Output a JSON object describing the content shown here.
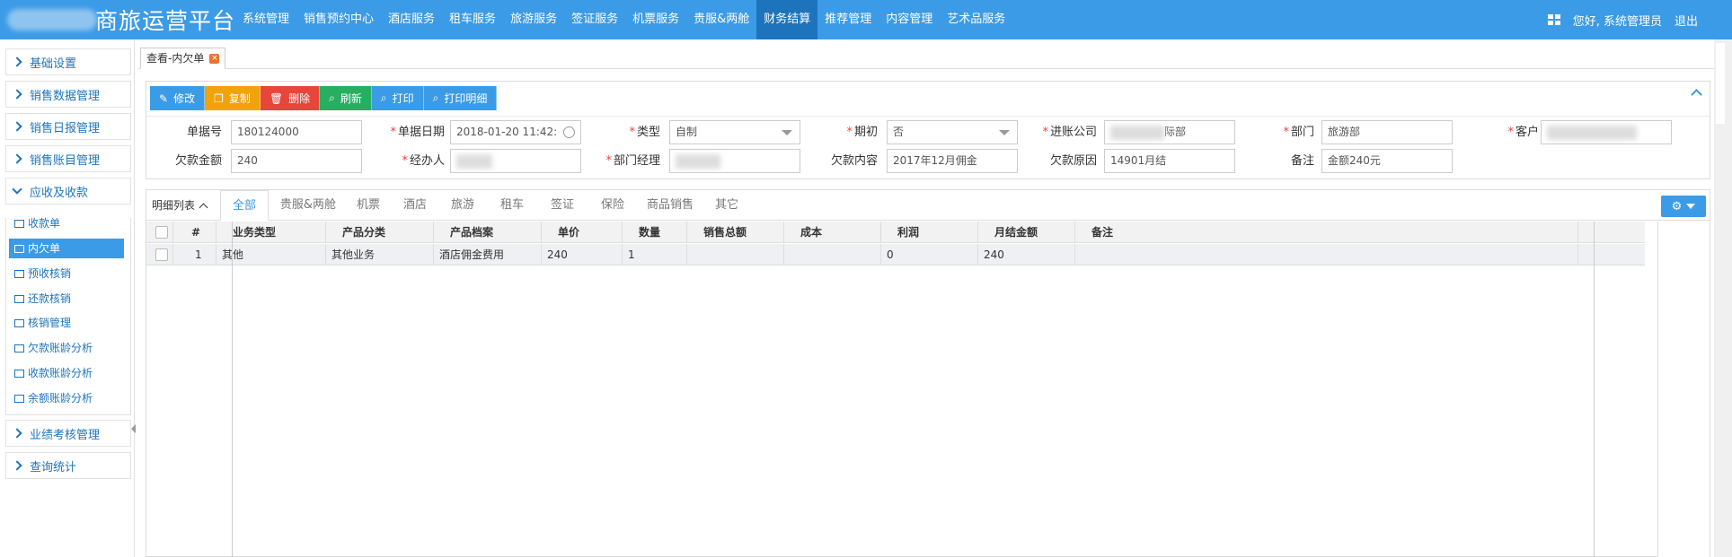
{
  "app": {
    "title": "商旅运营平台"
  },
  "nav": {
    "items": [
      "系统管理",
      "销售预约中心",
      "酒店服务",
      "租车服务",
      "旅游服务",
      "签证服务",
      "机票服务",
      "贵服&两舱",
      "财务结算",
      "推荐管理",
      "内容管理",
      "艺术品服务"
    ],
    "active_index": 8,
    "user_greeting": "您好, 系统管理员",
    "logout": "退出"
  },
  "sidebar": {
    "groups_top": [
      "基础设置",
      "销售数据管理",
      "销售日报管理",
      "销售账目管理"
    ],
    "expanded_group": "应收及收款",
    "sub_items": [
      "收款单",
      "内欠单",
      "预收核销",
      "还款核销",
      "核销管理",
      "欠款账龄分析",
      "收款账龄分析",
      "余额账龄分析"
    ],
    "active_sub_index": 1,
    "groups_bottom": [
      "业绩考核管理",
      "查询统计"
    ]
  },
  "tabs": {
    "current": "查看-内欠单",
    "close_icon": "×"
  },
  "toolbar": {
    "edit": "修改",
    "copy": "复制",
    "delete": "删除",
    "refresh": "刷新",
    "print": "打印",
    "print_detail": "打印明细"
  },
  "form": {
    "doc_no_label": "单据号",
    "doc_no": "180124000",
    "doc_date_label": "单据日期",
    "doc_date": "2018-01-20 11:42:",
    "type_label": "类型",
    "type": "自制",
    "initial_label": "期初",
    "initial": "否",
    "account_company_label": "进账公司",
    "account_company": "际部",
    "dept_label": "部门",
    "dept": "旅游部",
    "customer_label": "客户",
    "debt_amount_label": "欠款金额",
    "debt_amount": "240",
    "handler_label": "经办人",
    "dept_manager_label": "部门经理",
    "debt_content_label": "欠款内容",
    "debt_content": "2017年12月佣金",
    "debt_reason_label": "欠款原因",
    "debt_reason": "14901月结",
    "remark_label": "备注",
    "remark": "金额240元"
  },
  "detail": {
    "list_title": "明细列表",
    "tabs": [
      "全部",
      "贵服&两舱",
      "机票",
      "酒店",
      "旅游",
      "租车",
      "签证",
      "保险",
      "商品销售",
      "其它"
    ],
    "active_tab": 0,
    "columns": [
      "#",
      "业务类型",
      "产品分类",
      "产品档案",
      "单价",
      "数量",
      "销售总额",
      "成本",
      "利润",
      "月结金额",
      "备注"
    ],
    "rows": [
      {
        "no": "1",
        "biz_type": "其他",
        "category": "其他业务",
        "product": "酒店佣金费用",
        "price": "240",
        "qty": "1",
        "sales_total": "",
        "cost": "",
        "profit": "0",
        "monthly_amount": "240",
        "remark": ""
      }
    ]
  },
  "icons": {
    "edit": "pencil-icon",
    "copy": "copy-icon",
    "delete": "trash-icon",
    "refresh": "search-icon",
    "print": "zoom-icon",
    "settings": "gear-icon"
  },
  "colors": {
    "primary": "#3c9be6",
    "nav_active": "#1d74bd",
    "orange": "#f0a30a",
    "red": "#e8453c",
    "green": "#27ae60"
  }
}
